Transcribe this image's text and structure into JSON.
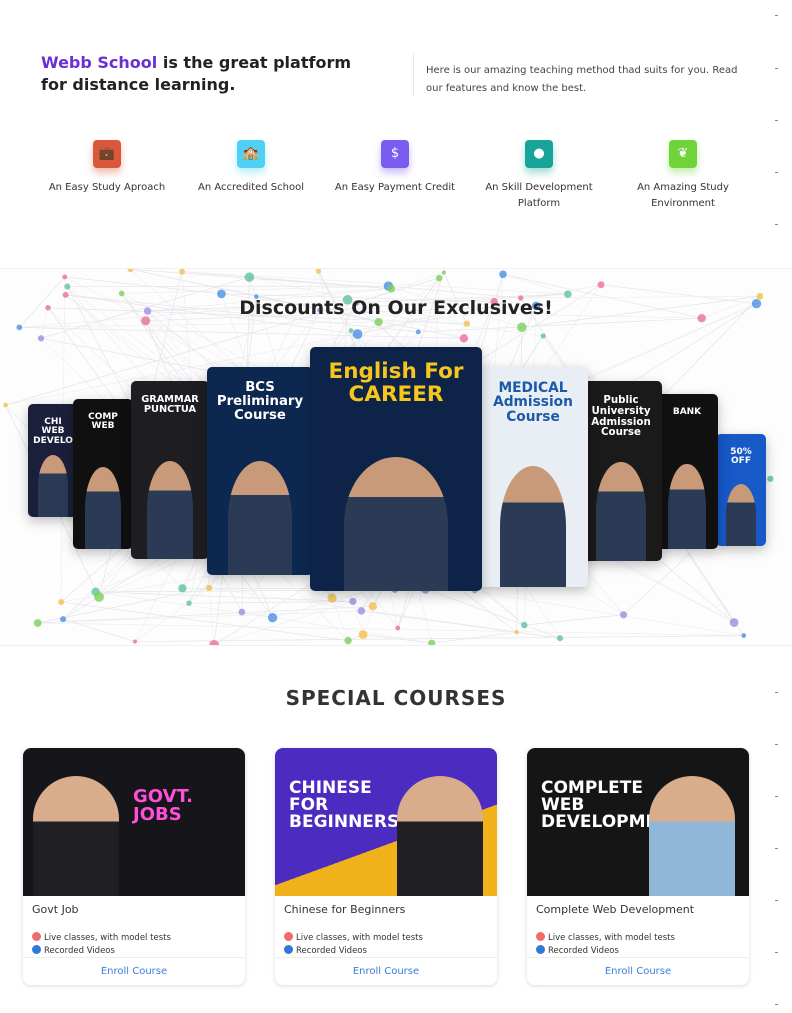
{
  "intro": {
    "brand": "Webb School",
    "headline_rest": " is the great platform for distance learning.",
    "description": "Here is our amazing teaching method thad suits for you. Read our features and know the best."
  },
  "features": [
    {
      "label": "An Easy Study Aproach",
      "icon": "briefcase-icon",
      "color": "#d9573b",
      "glyph": "💼"
    },
    {
      "label": "An Accredited School",
      "icon": "school-building-icon",
      "color": "#4fd0f5",
      "glyph": "🏫"
    },
    {
      "label": "An Easy Payment Credit",
      "icon": "payment-chat-icon",
      "color": "#7b5cf0",
      "glyph": "$"
    },
    {
      "label": "An Skill Development Platform",
      "icon": "brain-icon",
      "color": "#17a599",
      "glyph": "●"
    },
    {
      "label": "An Amazing Study Environment",
      "icon": "leaf-icon",
      "color": "#6fd43a",
      "glyph": "❦"
    }
  ],
  "discount": {
    "title": "Discounts On Our Exclusives!",
    "promos": [
      {
        "text": "CHI WEB DEVELO",
        "bg": "#1b1f3b"
      },
      {
        "text": "COMP WEB",
        "bg": "#101010"
      },
      {
        "text": "GRAMMAR PUNCTUA",
        "bg": "#1e1e22"
      },
      {
        "text": "BCS Preliminary Course",
        "bg": "#0d2850"
      },
      {
        "text": "English For CAREER",
        "bg": "#0e2348"
      },
      {
        "text": "MEDICAL Admission Course",
        "bg": "#e8eef4"
      },
      {
        "text": "Public University Admission Course",
        "bg": "#1a1a1a"
      },
      {
        "text": "BANK",
        "bg": "#111"
      },
      {
        "text": "50% OFF",
        "bg": "#1659c7"
      }
    ]
  },
  "special": {
    "title": "SPECIAL COURSES",
    "courses": [
      {
        "name": "Govt Job",
        "banner": "GOVT. JOBS",
        "bg": "#15151a",
        "feature1": "Live classes, with model tests",
        "feature2": "Recorded Videos",
        "enroll": "Enroll Course"
      },
      {
        "name": "Chinese for Beginners",
        "banner": "CHINESE FOR BEGINNERS",
        "bg": "#3a1fa8",
        "feature1": "Live classes, with model tests",
        "feature2": "Recorded Videos",
        "enroll": "Enroll Course"
      },
      {
        "name": "Complete Web Development",
        "banner": "COMPLETE WEB DEVELOPMENT",
        "bg": "#151515",
        "feature1": "Live classes, with model tests",
        "feature2": "Recorded Videos",
        "enroll": "Enroll Course"
      }
    ]
  }
}
